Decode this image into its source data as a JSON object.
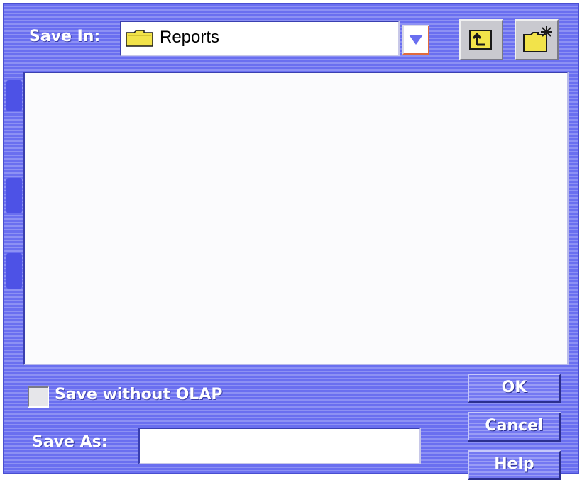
{
  "save_in": {
    "label": "Save In:",
    "folder_icon": "folder-icon",
    "selected_folder": "Reports",
    "dropdown_icon": "triangle-down-icon"
  },
  "toolbar": {
    "up_folder_icon": "up-one-level-icon",
    "new_folder_icon": "new-folder-icon"
  },
  "file_list": {
    "items": []
  },
  "options": {
    "save_without_olap_label": "Save without OLAP",
    "save_without_olap_checked": false
  },
  "save_as": {
    "label": "Save As:",
    "value": ""
  },
  "buttons": {
    "ok": "OK",
    "cancel": "Cancel",
    "help": "Help"
  },
  "colors": {
    "dialog_background": "#6a6ff0",
    "dialog_stripe": "#8d91f4",
    "label_text": "#ffffff",
    "dropdown_arrow": "#6a6ff0",
    "dropdown_accent": "#e06a3c",
    "folder_yellow": "#f2e34a"
  }
}
